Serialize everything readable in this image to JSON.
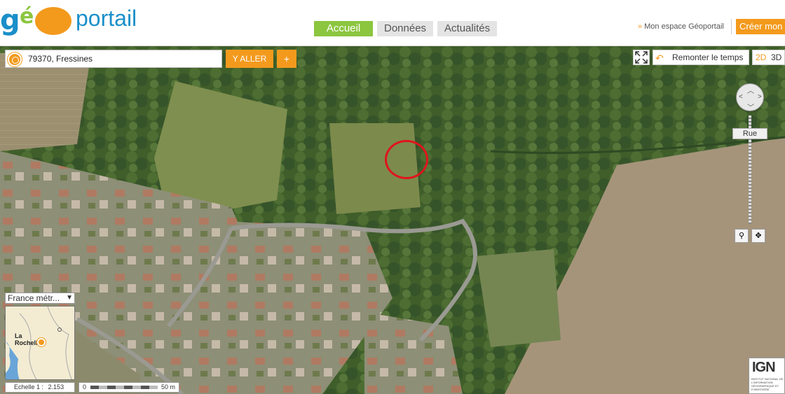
{
  "header": {
    "logo": {
      "text": "géoportail"
    },
    "nav": [
      {
        "label": "Accueil",
        "active": true
      },
      {
        "label": "Données",
        "active": false
      },
      {
        "label": "Actualités",
        "active": false
      }
    ],
    "espace_label": "Mon espace Géoportail",
    "create_label": "Créer mon"
  },
  "search": {
    "value": "79370, Fressines",
    "go_label": "Y ALLER",
    "plus_label": "+"
  },
  "toolbar": {
    "time_label": "Remonter le temps",
    "view_2d": "2D",
    "view_3d": "3D"
  },
  "zoom": {
    "level_label": "Rue"
  },
  "overview": {
    "projection": "France métr...",
    "city": "La Rochelle"
  },
  "scale": {
    "ratio_label": "Echelle 1 :",
    "ratio_value": "2.153",
    "zero": "0",
    "max": "50 m"
  },
  "ign": {
    "logo": "IGN",
    "subtitle": "INSTITUT NATIONAL DE L'INFORMATION GÉOGRAPHIQUE ET FORESTIÈRE"
  },
  "colors": {
    "brand_blue": "#1a8fc9",
    "brand_green": "#8cc63f",
    "brand_orange": "#f39a1d",
    "marker_red": "#e0141b"
  },
  "icons": [
    "search-target-icon",
    "fullscreen-icon",
    "undo-icon",
    "pan-icon",
    "magnifier-icon",
    "center-icon"
  ]
}
